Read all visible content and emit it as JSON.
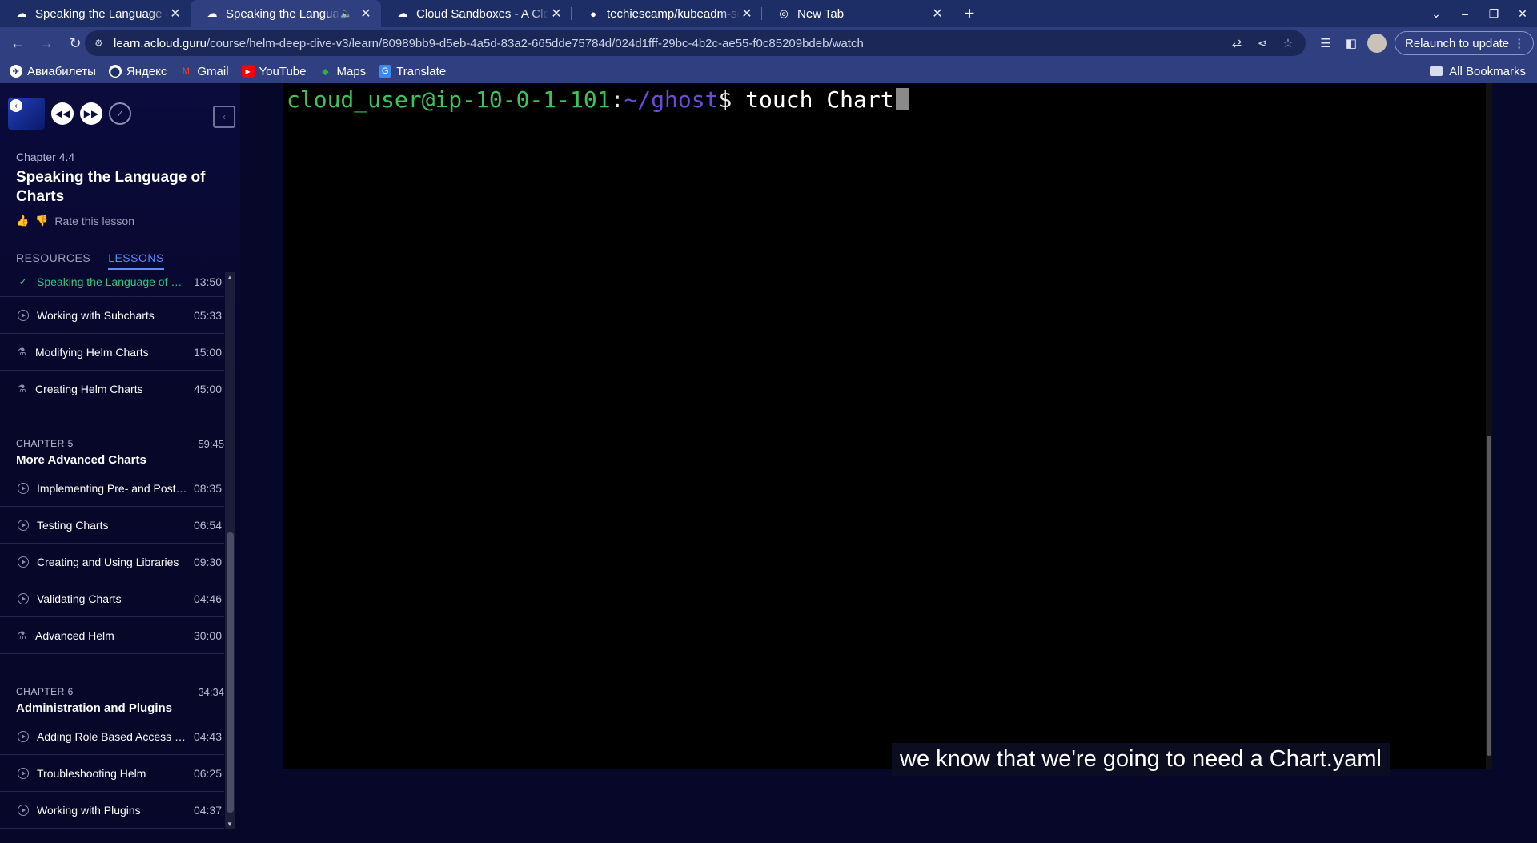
{
  "browser": {
    "tabs": [
      {
        "title": "Speaking the Language of Charts",
        "active": false
      },
      {
        "title": "Speaking the Language of Charts",
        "active": true
      },
      {
        "title": "Cloud Sandboxes - A Cloud Guru",
        "active": false
      },
      {
        "title": "techiescamp/kubeadm-scripts",
        "active": false
      },
      {
        "title": "New Tab",
        "active": false
      }
    ],
    "url_host": "learn.acloud.guru",
    "url_path": "/course/helm-deep-dive-v3/learn/80989bb9-d5eb-4a5d-83a2-665dde75784d/024d1fff-29bc-4b2c-ae55-f0c85209bdeb/watch",
    "relaunch_label": "Relaunch to update",
    "bookmarks": [
      "Авиабилеты",
      "Яндекс",
      "Gmail",
      "YouTube",
      "Maps",
      "Translate"
    ],
    "all_bookmarks": "All Bookmarks"
  },
  "sidebar": {
    "chapter_label": "Chapter 4.4",
    "lesson_title": "Speaking the Language of Charts",
    "rate_label": "Rate this lesson",
    "tab_resources": "RESOURCES",
    "tab_lessons": "LESSONS",
    "lessons_top": [
      {
        "name": "Speaking the Language of Charts",
        "duration": "13:50",
        "icon": "check-icon",
        "current": true
      },
      {
        "name": "Working with Subcharts",
        "duration": "05:33",
        "icon": "play-circle-icon"
      },
      {
        "name": "Modifying Helm Charts",
        "duration": "15:00",
        "icon": "lab-flask-icon"
      },
      {
        "name": "Creating Helm Charts",
        "duration": "45:00",
        "icon": "lab-flask-icon"
      }
    ],
    "chapter5": {
      "label": "CHAPTER 5",
      "duration": "59:45",
      "title": "More Advanced Charts"
    },
    "lessons_ch5": [
      {
        "name": "Implementing Pre- and Post-Hooks",
        "duration": "08:35",
        "icon": "play-circle-icon"
      },
      {
        "name": "Testing Charts",
        "duration": "06:54",
        "icon": "play-circle-icon"
      },
      {
        "name": "Creating and Using Libraries",
        "duration": "09:30",
        "icon": "play-circle-icon"
      },
      {
        "name": "Validating Charts",
        "duration": "04:46",
        "icon": "play-circle-icon"
      },
      {
        "name": "Advanced Helm",
        "duration": "30:00",
        "icon": "lab-flask-icon"
      }
    ],
    "chapter6": {
      "label": "CHAPTER 6",
      "duration": "34:34",
      "title": "Administration and Plugins"
    },
    "lessons_ch6": [
      {
        "name": "Adding Role Based Access Control",
        "duration": "04:43",
        "icon": "play-circle-icon"
      },
      {
        "name": "Troubleshooting Helm",
        "duration": "06:25",
        "icon": "play-circle-icon"
      },
      {
        "name": "Working with Plugins",
        "duration": "04:37",
        "icon": "play-circle-icon"
      }
    ]
  },
  "terminal": {
    "user_host": "cloud_user@ip-10-0-1-101",
    "colon": ":",
    "path": "~/ghost",
    "dollar": "$ ",
    "command": "touch Chart"
  },
  "caption": "we know that we're going to need a Chart.yaml",
  "colors": {
    "accent": "#5d8dff",
    "done": "#2ec97e",
    "prompt_user": "#3ec25a",
    "prompt_path": "#6d4ad8"
  }
}
